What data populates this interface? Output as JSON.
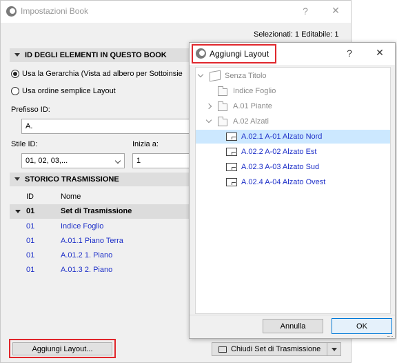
{
  "main": {
    "title": "Impostazioni Book",
    "help": "?",
    "close": "✕",
    "selection_status": "Selezionati: 1 Editabile: 1",
    "section_ids": "ID DEGLI ELEMENTI IN QUESTO BOOK",
    "radio_hierarchy": "Usa la Gerarchia (Vista ad albero per Sottoinsie",
    "radio_simple": "Usa ordine semplice Layout",
    "prefix_label": "Prefisso ID:",
    "prefix_value": "A.",
    "style_label": "Stile ID:",
    "style_value": "01, 02, 03,...",
    "start_label": "Inizia a:",
    "start_value": "1",
    "section_history": "STORICO TRASMISSIONE",
    "col_id": "ID",
    "col_name": "Nome",
    "set_id": "01",
    "set_name": "Set di Trasmissione",
    "rows": [
      {
        "id": "01",
        "name": "Indice Foglio"
      },
      {
        "id": "01",
        "name": "A.01.1 Piano Terra"
      },
      {
        "id": "01",
        "name": "A.01.2 1. Piano"
      },
      {
        "id": "01",
        "name": "A.01.3 2. Piano"
      }
    ],
    "add_layout_button": "Aggiungi Layout...",
    "close_set_button": "Chiudi Set di Trasmissione"
  },
  "sub": {
    "title": "Aggiungi Layout",
    "help": "?",
    "close": "✕",
    "tree": [
      {
        "label": "Senza Titolo",
        "kind": "book",
        "expanded": true
      },
      {
        "label": "Indice Foglio",
        "kind": "folder"
      },
      {
        "label": "A.01 Piante",
        "kind": "folder",
        "expanded": false
      },
      {
        "label": "A.02 Alzati",
        "kind": "folder",
        "expanded": true
      },
      {
        "label": "A.02.1 A-01 Alzato Nord",
        "kind": "sheet",
        "selected": true
      },
      {
        "label": "A.02.2 A-02 Alzato Est",
        "kind": "sheet"
      },
      {
        "label": "A.02.3 A-03 Alzato Sud",
        "kind": "sheet"
      },
      {
        "label": "A.02.4 A-04 Alzato Ovest",
        "kind": "sheet"
      }
    ],
    "cancel_button": "Annulla",
    "ok_button": "OK"
  },
  "colors": {
    "accent_blue": "#1d2fc8",
    "highlight_red": "#e0262b",
    "selection_bg": "#cce8ff"
  }
}
